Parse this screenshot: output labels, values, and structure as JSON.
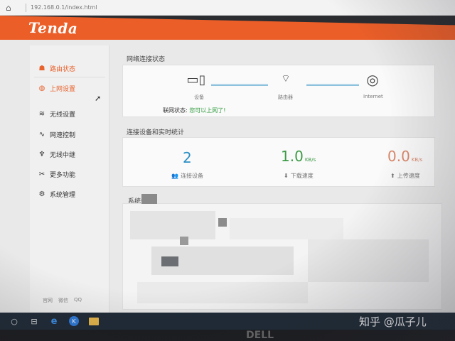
{
  "browser": {
    "address": "192.168.0.1/index.html"
  },
  "brand": {
    "logo_text": "Tenda",
    "header_color": "#eb5e28"
  },
  "sidebar": {
    "items": [
      {
        "label": "路由状态",
        "icon": "router-status-icon",
        "active": true
      },
      {
        "label": "上网设置",
        "icon": "globe-icon",
        "active": true
      },
      {
        "label": "无线设置",
        "icon": "wifi-icon",
        "active": false
      },
      {
        "label": "网速控制",
        "icon": "speed-chart-icon",
        "active": false
      },
      {
        "label": "无线中继",
        "icon": "antenna-icon",
        "active": false
      },
      {
        "label": "更多功能",
        "icon": "tools-icon",
        "active": false
      },
      {
        "label": "系统管理",
        "icon": "gear-icon",
        "active": false
      }
    ],
    "footer_links": [
      "官网",
      "微信",
      "QQ"
    ]
  },
  "network_status": {
    "title": "网络连接状态",
    "devices": [
      {
        "label": "设备",
        "icon": "computer-phone-icon"
      },
      {
        "label": "路由器",
        "icon": "router-icon"
      },
      {
        "label": "Internet",
        "icon": "globe-icon"
      }
    ],
    "status_label": "联网状态:",
    "status_value": "您可以上网了!"
  },
  "stats": {
    "title": "连接设备和实时统计",
    "connected_devices": {
      "value": "2",
      "label": "连接设备",
      "color": "#2b8fc4"
    },
    "download": {
      "value": "1.0",
      "unit": "KB/s",
      "label": "下载速度",
      "color": "#3d9a46"
    },
    "upload": {
      "value": "0.0",
      "unit": "KB/s",
      "label": "上传速度",
      "color": "#d9876a"
    }
  },
  "system_info": {
    "title": "系统信息"
  },
  "taskbar": {
    "k_app_letter": "K"
  },
  "bezel": {
    "brand": "DELL"
  },
  "watermark": {
    "text": "知乎 @瓜子儿"
  }
}
